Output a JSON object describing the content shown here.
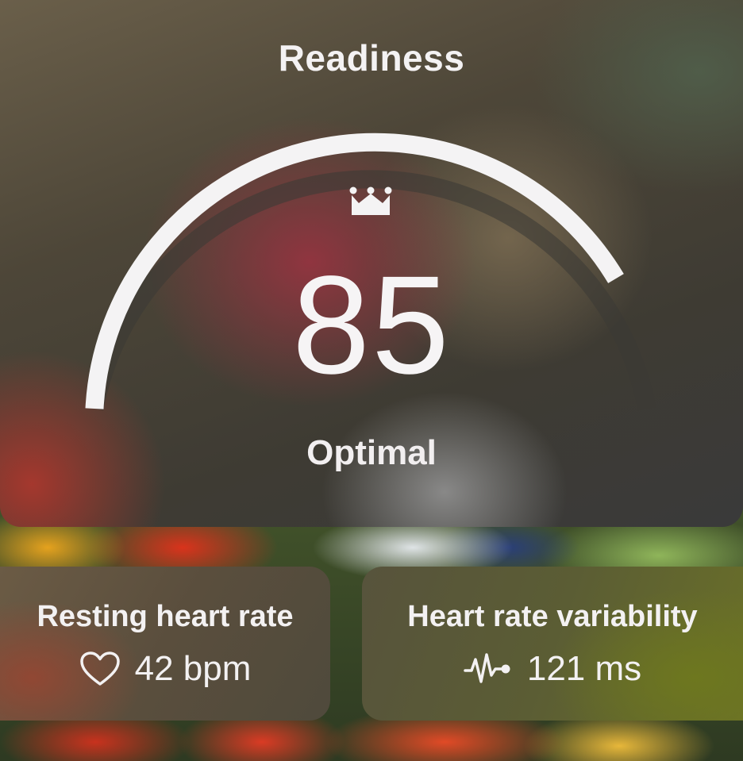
{
  "readiness": {
    "title": "Readiness",
    "score": "85",
    "status": "Optimal",
    "crown_icon": "crown-icon",
    "gauge_fraction": 0.85
  },
  "resting_heart_rate": {
    "title": "Resting heart rate",
    "value": "42 bpm",
    "icon": "heart-icon"
  },
  "heart_rate_variability": {
    "title": "Heart rate variability",
    "value": "121 ms",
    "icon": "pulse-wave-icon"
  },
  "colors": {
    "gauge_fill": "#f4f3f4",
    "gauge_track": "#3c3a36",
    "text": "#f3f1f2"
  }
}
